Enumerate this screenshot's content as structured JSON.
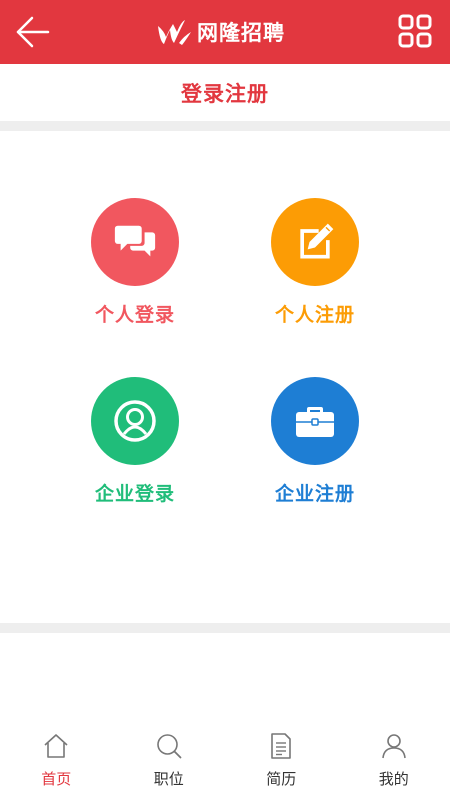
{
  "header": {
    "back_icon": "arrow-left-icon",
    "brand_logo": "brand-logo-icon",
    "title": "网隆招聘",
    "menu_icon": "grid-menu-icon",
    "color": "#e2373f"
  },
  "page": {
    "subtitle": "登录注册"
  },
  "options": [
    {
      "label": "个人登录",
      "icon": "chat-bubbles-icon",
      "color": "#f1575f"
    },
    {
      "label": "个人注册",
      "icon": "edit-pencil-icon",
      "color": "#fc9c05"
    },
    {
      "label": "企业登录",
      "icon": "user-circle-icon",
      "color": "#20bd7a"
    },
    {
      "label": "企业注册",
      "icon": "briefcase-icon",
      "color": "#1e7ed4"
    }
  ],
  "nav": {
    "items": [
      {
        "label": "首页",
        "icon": "home-icon",
        "active": true
      },
      {
        "label": "职位",
        "icon": "search-icon",
        "active": false
      },
      {
        "label": "简历",
        "icon": "document-icon",
        "active": false
      },
      {
        "label": "我的",
        "icon": "person-icon",
        "active": false
      }
    ],
    "active_color": "#e2373f"
  }
}
